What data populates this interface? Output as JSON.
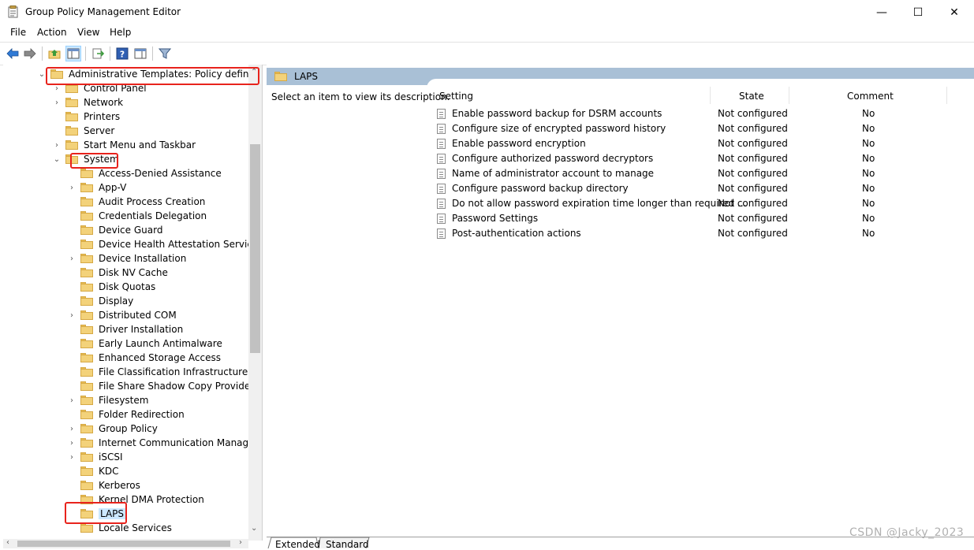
{
  "window": {
    "title": "Group Policy Management Editor",
    "minimize_glyph": "—",
    "maximize_glyph": "☐",
    "close_glyph": "✕"
  },
  "menu": {
    "items": [
      "File",
      "Action",
      "View",
      "Help"
    ]
  },
  "toolbar": {
    "icons": [
      "back-arrow-icon",
      "forward-arrow-icon",
      "up-folder-icon",
      "show-hide-console-tree-icon",
      "export-list-icon",
      "help-icon",
      "show-action-pane-icon",
      "filter-icon"
    ]
  },
  "tree": {
    "root_label": "Administrative Templates: Policy definitions",
    "items": [
      {
        "label": "Control Panel",
        "chevron": "›"
      },
      {
        "label": "Network",
        "chevron": "›"
      },
      {
        "label": "Printers",
        "chevron": ""
      },
      {
        "label": "Server",
        "chevron": ""
      },
      {
        "label": "Start Menu and Taskbar",
        "chevron": "›"
      },
      {
        "label": "System",
        "chevron": "⌄"
      },
      {
        "label": "Access-Denied Assistance",
        "chevron": ""
      },
      {
        "label": "App-V",
        "chevron": "›"
      },
      {
        "label": "Audit Process Creation",
        "chevron": ""
      },
      {
        "label": "Credentials Delegation",
        "chevron": ""
      },
      {
        "label": "Device Guard",
        "chevron": ""
      },
      {
        "label": "Device Health Attestation Service",
        "chevron": ""
      },
      {
        "label": "Device Installation",
        "chevron": "›"
      },
      {
        "label": "Disk NV Cache",
        "chevron": ""
      },
      {
        "label": "Disk Quotas",
        "chevron": ""
      },
      {
        "label": "Display",
        "chevron": ""
      },
      {
        "label": "Distributed COM",
        "chevron": "›"
      },
      {
        "label": "Driver Installation",
        "chevron": ""
      },
      {
        "label": "Early Launch Antimalware",
        "chevron": ""
      },
      {
        "label": "Enhanced Storage Access",
        "chevron": ""
      },
      {
        "label": "File Classification Infrastructure",
        "chevron": ""
      },
      {
        "label": "File Share Shadow Copy Provider",
        "chevron": ""
      },
      {
        "label": "Filesystem",
        "chevron": "›"
      },
      {
        "label": "Folder Redirection",
        "chevron": ""
      },
      {
        "label": "Group Policy",
        "chevron": "›"
      },
      {
        "label": "Internet Communication Manageme",
        "chevron": "›"
      },
      {
        "label": "iSCSI",
        "chevron": "›"
      },
      {
        "label": "KDC",
        "chevron": ""
      },
      {
        "label": "Kerberos",
        "chevron": ""
      },
      {
        "label": "Kernel DMA Protection",
        "chevron": ""
      },
      {
        "label": "LAPS",
        "chevron": "",
        "selected": true
      },
      {
        "label": "Locale Services",
        "chevron": ""
      }
    ]
  },
  "details": {
    "header": "LAPS",
    "description": "Select an item to view its description.",
    "columns": {
      "setting": "Setting",
      "state": "State",
      "comment": "Comment"
    },
    "rows": [
      {
        "setting": "Enable password backup for DSRM accounts",
        "state": "Not configured",
        "comment": "No"
      },
      {
        "setting": "Configure size of encrypted password history",
        "state": "Not configured",
        "comment": "No"
      },
      {
        "setting": "Enable password encryption",
        "state": "Not configured",
        "comment": "No"
      },
      {
        "setting": "Configure authorized password decryptors",
        "state": "Not configured",
        "comment": "No"
      },
      {
        "setting": "Name of administrator account to manage",
        "state": "Not configured",
        "comment": "No"
      },
      {
        "setting": "Configure password backup directory",
        "state": "Not configured",
        "comment": "No"
      },
      {
        "setting": "Do not allow password expiration time longer than required ...",
        "state": "Not configured",
        "comment": "No"
      },
      {
        "setting": "Password Settings",
        "state": "Not configured",
        "comment": "No"
      },
      {
        "setting": "Post-authentication actions",
        "state": "Not configured",
        "comment": "No"
      }
    ]
  },
  "tabs": [
    "Extended",
    "Standard"
  ],
  "watermark": "CSDN @Jacky_2023",
  "colors": {
    "annotation_red": "#e8231c",
    "header_blue": "#a9c0d6",
    "selection": "#cce8ff"
  }
}
